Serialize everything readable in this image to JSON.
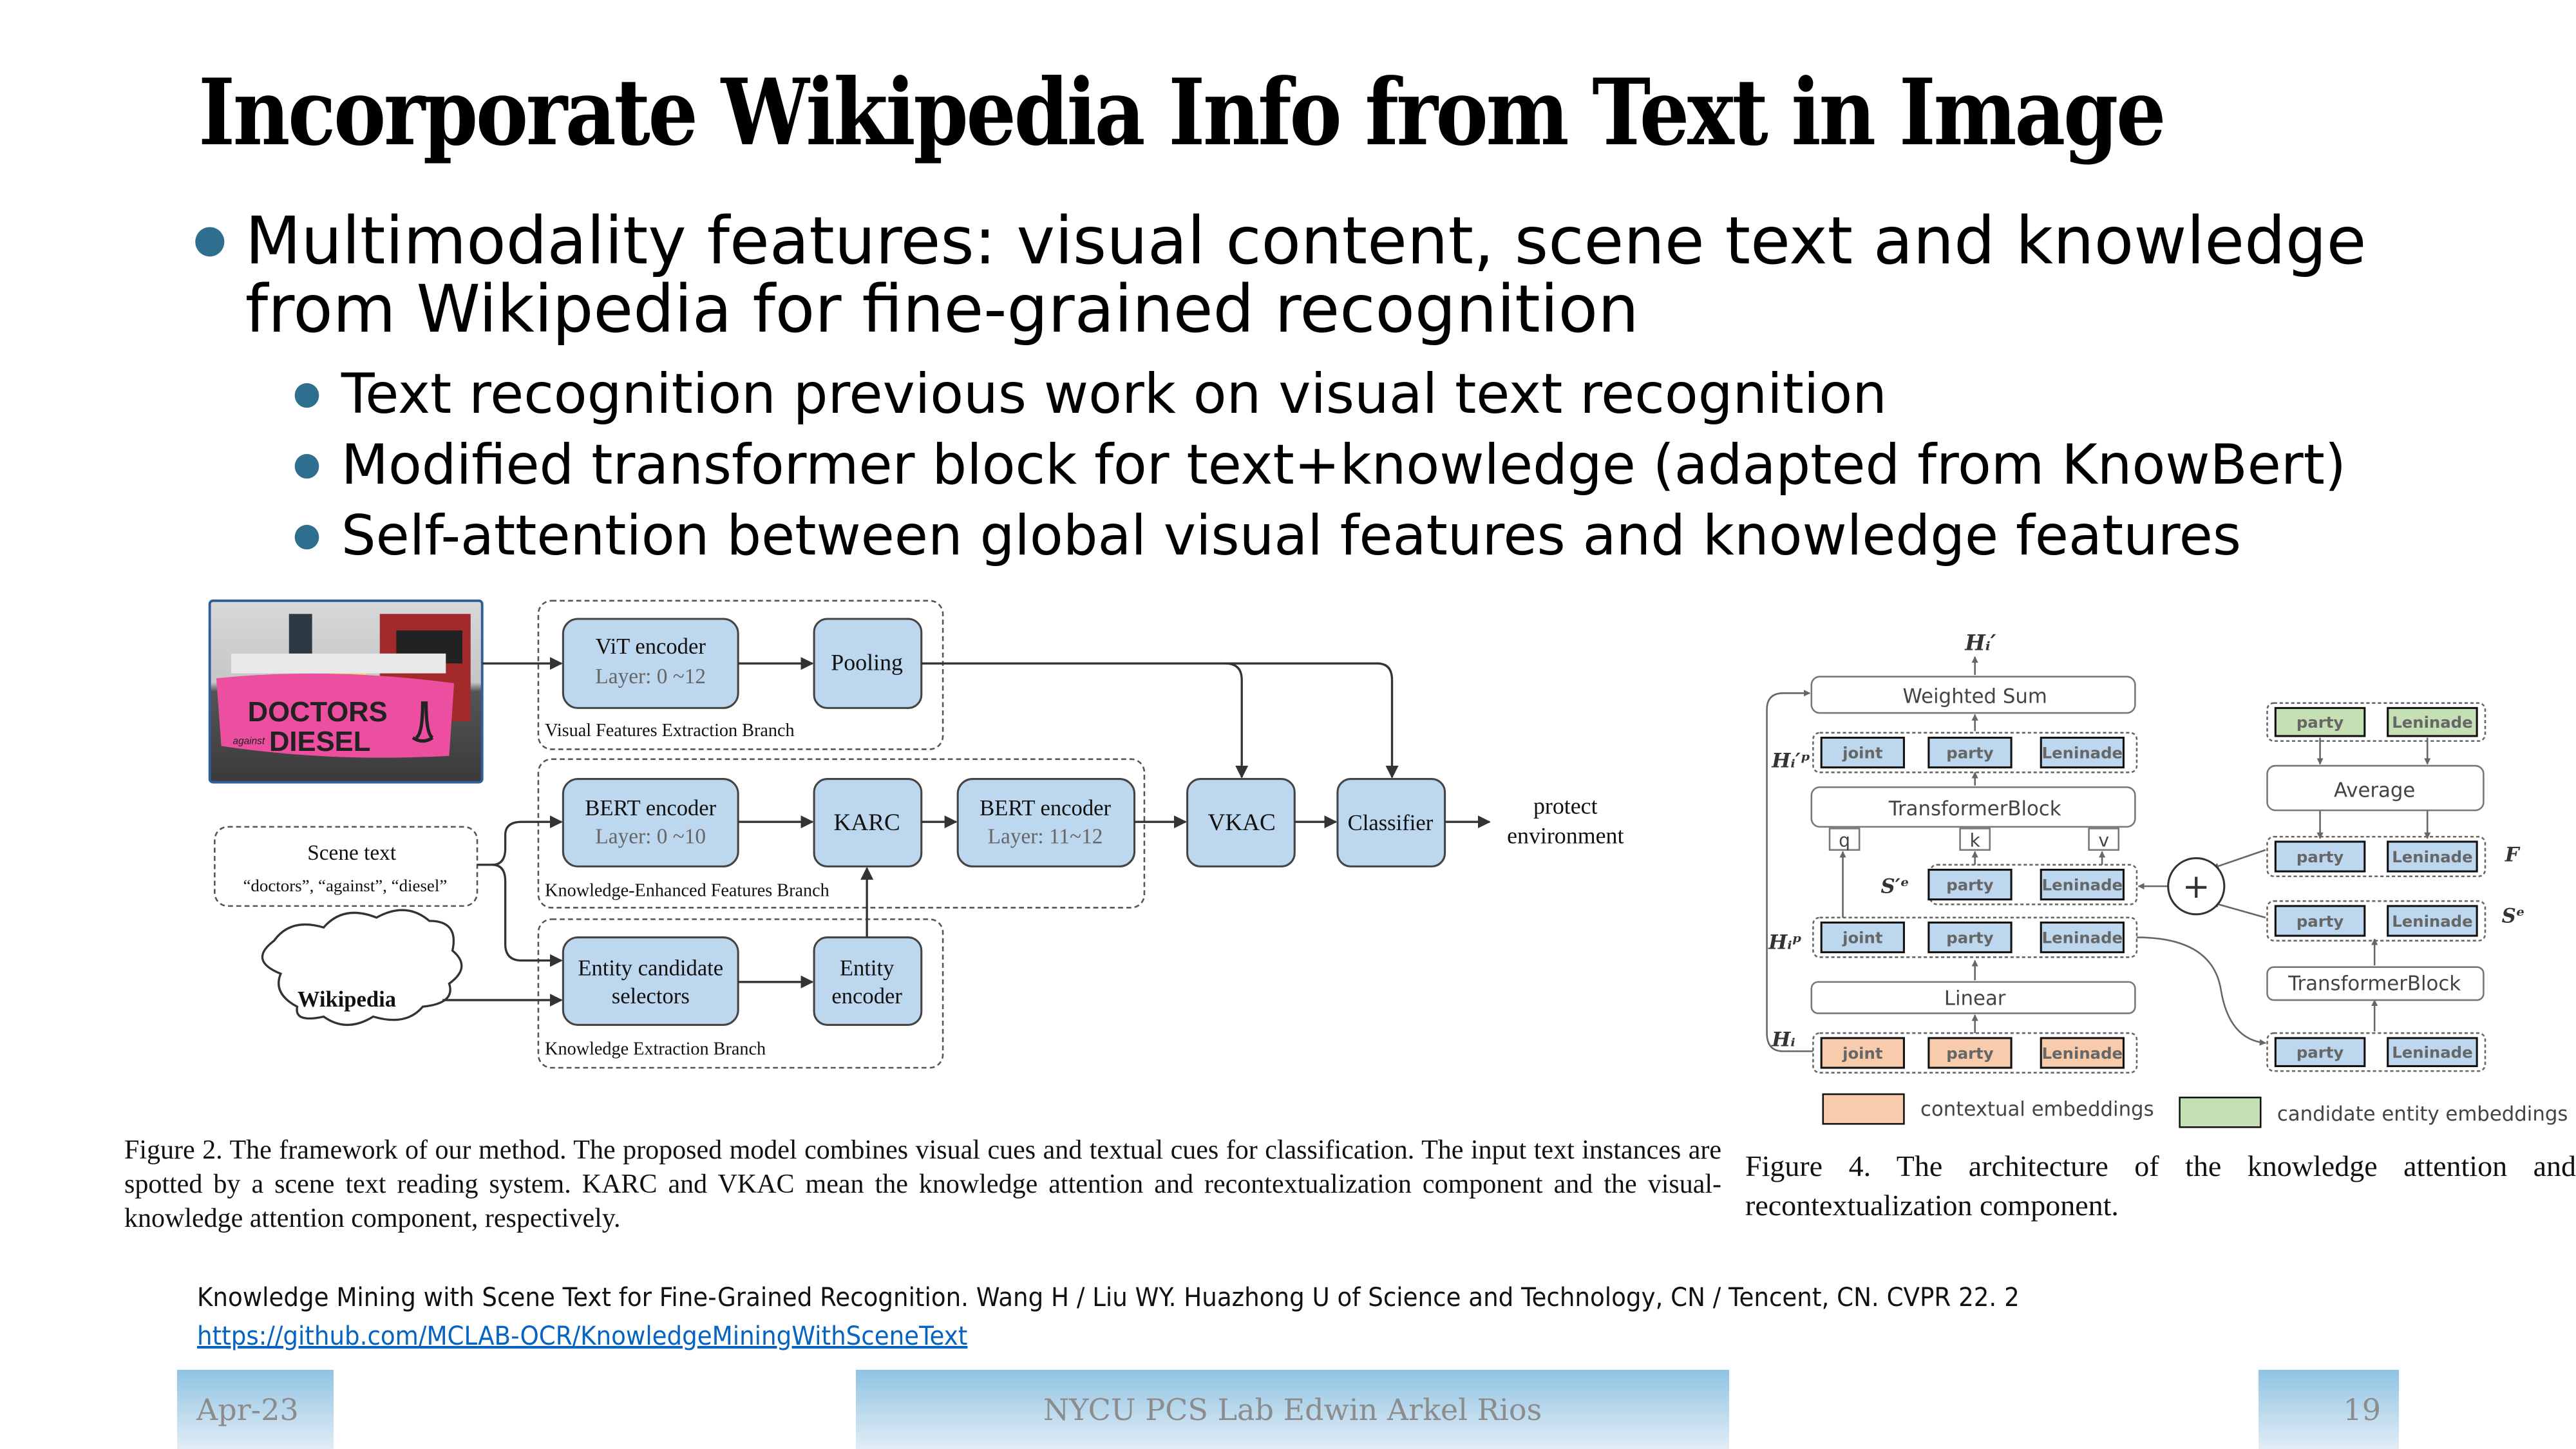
{
  "slide": {
    "title": "Incorporate Wikipedia Info from Text in Image",
    "bullets": [
      {
        "level": 1,
        "line1": "Multimodality features: visual content, scene text and knowledge",
        "line2": "from Wikipedia for fine-grained recognition"
      },
      {
        "level": 2,
        "text": "Text recognition previous work on visual text recognition"
      },
      {
        "level": 2,
        "text": "Modified transformer block for text+knowledge (adapted from KnowBert)"
      },
      {
        "level": 2,
        "text": "Self-attention between global visual features and knowledge features"
      }
    ],
    "bullet_color": "#2e6e8e"
  },
  "figure2": {
    "photo_alt": "Photo of protest banner: DOCTORS against DIESEL",
    "photo_banner_line1": "DOCTORS",
    "photo_banner_small": "against",
    "photo_banner_line2": "DIESEL",
    "vit_encoder": {
      "title": "ViT  encoder",
      "sub": "Layer: 0 ~12"
    },
    "pooling": "Pooling",
    "visual_branch_label": "Visual Features Extraction Branch",
    "scene_text": {
      "title": "Scene text",
      "words": "“doctors”, “against”, “diesel”"
    },
    "bert_encoder_1": {
      "title": "BERT encoder",
      "sub": "Layer: 0 ~10"
    },
    "karc": "KARC",
    "bert_encoder_2": {
      "title": "BERT encoder",
      "sub": "Layer: 11~12"
    },
    "knowledge_enhanced_branch_label": "Knowledge-Enhanced Features Branch",
    "vkac": "VKAC",
    "classifier": "Classifier",
    "output_line1": "protect",
    "output_line2": "environment",
    "wikipedia": "Wikipedia",
    "entity_selectors": {
      "line1": "Entity candidate",
      "line2": "selectors"
    },
    "entity_encoder": {
      "line1": "Entity",
      "line2": "encoder"
    },
    "knowledge_extraction_branch_label": "Knowledge Extraction Branch",
    "caption": "Figure 2.  The framework of our method.  The proposed model combines visual cues and textual cues for classification.  The input text instances are spotted by a scene text reading system. KARC and VKAC mean the knowledge attention and recontextualization component and the visual-knowledge attention component, respectively.",
    "box_fill": "#bdd7ee"
  },
  "figure4": {
    "h_i_prime": "Hᵢ′",
    "weighted_sum": "Weighted Sum",
    "h_ip_prime_label": "Hᵢ′ᵖ",
    "h_ip_prime_tokens": [
      "joint",
      "party",
      "Leninade"
    ],
    "transformer_block_left": "TransformerBlock",
    "qkv": [
      "q",
      "k",
      "v"
    ],
    "s_prime_e_label": "S′ᵉ",
    "s_prime_e_tokens": [
      "party",
      "Leninade"
    ],
    "h_ip_label": "Hᵢᵖ",
    "h_ip_tokens": [
      "joint",
      "party",
      "Leninade"
    ],
    "linear": "Linear",
    "h_i_label": "Hᵢ",
    "h_i_tokens": [
      "joint",
      "party",
      "Leninade"
    ],
    "plus": "+",
    "candidate_tokens": [
      "party",
      "Leninade"
    ],
    "average": "Average",
    "f_label": "F",
    "f_tokens": [
      "party",
      "Leninade"
    ],
    "s_e_label": "Sᵉ",
    "s_e_tokens": [
      "party",
      "Leninade"
    ],
    "transformer_block_right": "TransformerBlock",
    "bottom_right_tokens": [
      "party",
      "Leninade"
    ],
    "legend": [
      {
        "label": "contextual embeddings",
        "color": "#f8cbad"
      },
      {
        "label": "candidate entity embeddings",
        "color": "#c5e0b4"
      }
    ],
    "token_blue": "#bdd7ee",
    "caption": "Figure 4.  The architecture of the knowledge attention and recontextualization component."
  },
  "reference": {
    "citation": "Knowledge Mining with Scene Text for Fine-Grained Recognition. Wang H / Liu WY. Huazhong U of Science and Technology, CN / Tencent, CN. CVPR 22. 2",
    "link_text": "https://github.com/MCLAB-OCR/KnowledgeMiningWithSceneText"
  },
  "footer": {
    "date": "Apr-23",
    "center": "NYCU PCS Lab Edwin Arkel Rios",
    "page_number": "19"
  }
}
